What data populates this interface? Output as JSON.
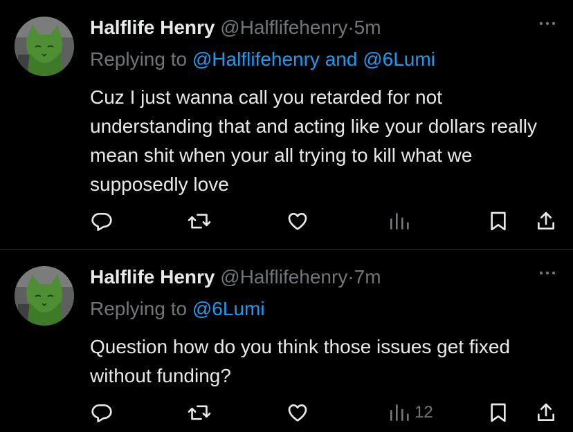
{
  "tweets": [
    {
      "author_name": "Halflife Henry",
      "author_handle": "@Halflifehenry",
      "separator": "·",
      "time": "5m",
      "replying_prefix": "Replying to",
      "replying_mention_1": "@Halflifehenry",
      "replying_joiner": "and",
      "replying_mention_2": "@6Lumi",
      "text": "Cuz I just wanna call you retarded for not understanding that and acting like your dollars really mean shit when your all trying to kill what we supposedly love",
      "views_count": ""
    },
    {
      "author_name": "Halflife Henry",
      "author_handle": "@Halflifehenry",
      "separator": "·",
      "time": "7m",
      "replying_prefix": "Replying to",
      "replying_mention_1": "@6Lumi",
      "text": "Question how do you think those issues get fixed without funding?",
      "views_count": "12"
    }
  ],
  "colors": {
    "background": "#000000",
    "text_primary": "#e7e9ea",
    "text_secondary": "#71767b",
    "link": "#1d9bf0",
    "divider": "#2f3336"
  },
  "icons": [
    "more-icon",
    "reply-icon",
    "repost-icon",
    "like-icon",
    "views-icon",
    "bookmark-icon",
    "share-icon"
  ]
}
